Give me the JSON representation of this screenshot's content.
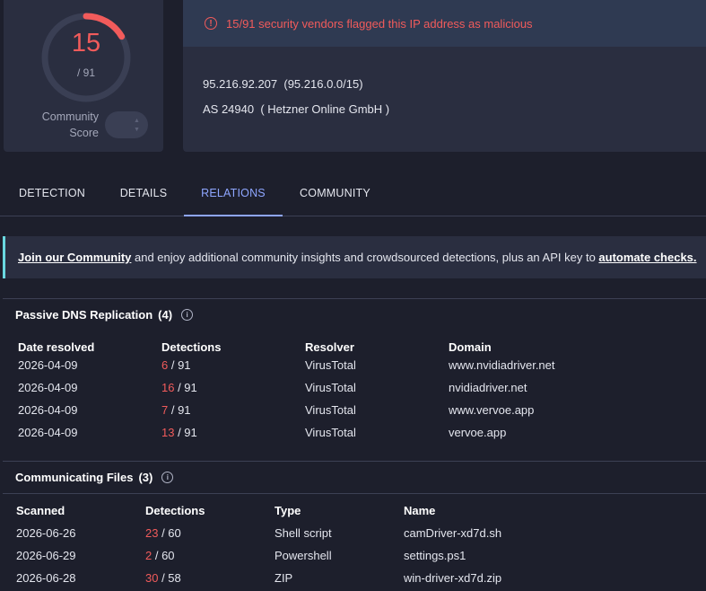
{
  "score": {
    "detected": "15",
    "total": "/ 91",
    "detected_fraction": 0.165,
    "label_line1": "Community",
    "label_line2": "Score",
    "color": "#f15b5b",
    "track_color": "#3a3f54"
  },
  "alert": {
    "icon": "alert-circle-icon",
    "text": "15/91 security vendors flagged this IP address as malicious",
    "color": "#f15b5b"
  },
  "ip_info": {
    "ip": "95.216.92.207",
    "network": "(95.216.0.0/15)",
    "asn": "AS 24940",
    "owner": "( Hetzner Online GmbH )"
  },
  "tabs": [
    {
      "label": "DETECTION",
      "active": false
    },
    {
      "label": "DETAILS",
      "active": false
    },
    {
      "label": "RELATIONS",
      "active": true
    },
    {
      "label": "COMMUNITY",
      "active": false
    }
  ],
  "banner": {
    "link1": "Join our Community",
    "middle": " and enjoy additional community insights and crowdsourced detections, plus an API key to ",
    "link2": "automate checks.",
    "accent": "#6ad8e0"
  },
  "passive_dns": {
    "title": "Passive DNS Replication",
    "count": "(4)",
    "columns": [
      "Date resolved",
      "Detections",
      "Resolver",
      "Domain"
    ],
    "rows": [
      {
        "date": "2026-04-09",
        "det": "6",
        "total": " / 91",
        "resolver": "VirusTotal",
        "domain": "www.nvidiadriver.net"
      },
      {
        "date": "2026-04-09",
        "det": "16",
        "total": " / 91",
        "resolver": "VirusTotal",
        "domain": "nvidiadriver.net"
      },
      {
        "date": "2026-04-09",
        "det": "7",
        "total": " / 91",
        "resolver": "VirusTotal",
        "domain": "www.vervoe.app"
      },
      {
        "date": "2026-04-09",
        "det": "13",
        "total": " / 91",
        "resolver": "VirusTotal",
        "domain": "vervoe.app"
      }
    ]
  },
  "communicating_files": {
    "title": "Communicating Files",
    "count": "(3)",
    "columns": [
      "Scanned",
      "Detections",
      "Type",
      "Name"
    ],
    "rows": [
      {
        "date": "2026-06-26",
        "det": "23",
        "total": " / 60",
        "type": "Shell script",
        "name": "camDriver-xd7d.sh"
      },
      {
        "date": "2026-06-29",
        "det": "2",
        "total": " / 60",
        "type": "Powershell",
        "name": "settings.ps1"
      },
      {
        "date": "2026-06-28",
        "det": "30",
        "total": " / 58",
        "type": "ZIP",
        "name": "win-driver-xd7d.zip"
      }
    ]
  }
}
